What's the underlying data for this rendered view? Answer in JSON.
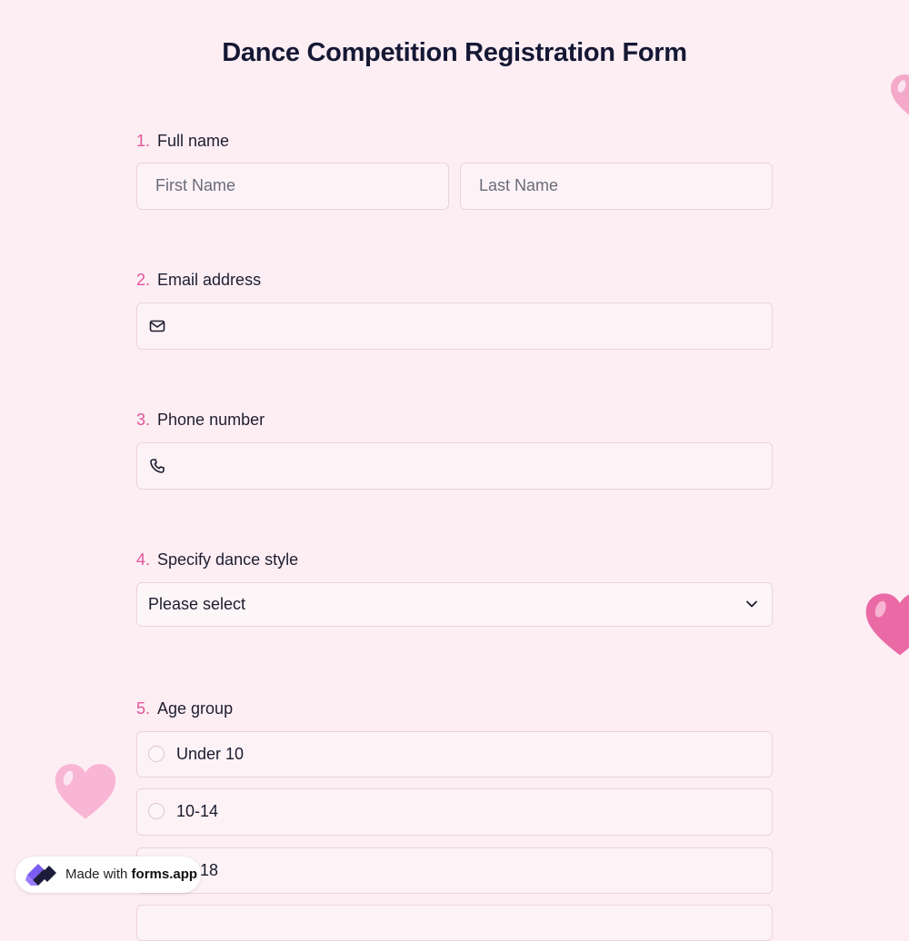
{
  "form": {
    "title": "Dance Competition Registration Form",
    "questions": [
      {
        "number": "1.",
        "label": "Full name",
        "first_placeholder": "First Name",
        "last_placeholder": "Last Name"
      },
      {
        "number": "2.",
        "label": "Email address",
        "icon": "envelope-icon"
      },
      {
        "number": "3.",
        "label": "Phone number",
        "icon": "phone-icon"
      },
      {
        "number": "4.",
        "label": "Specify dance style",
        "selected": "Please select"
      },
      {
        "number": "5.",
        "label": "Age group",
        "options": [
          "Under 10",
          "10-14",
          "15-18"
        ]
      }
    ]
  },
  "badge": {
    "prefix": "Made with",
    "brand": "forms.app"
  },
  "colors": {
    "background": "#fdeef4",
    "accent": "#e2559a",
    "title": "#151834"
  }
}
